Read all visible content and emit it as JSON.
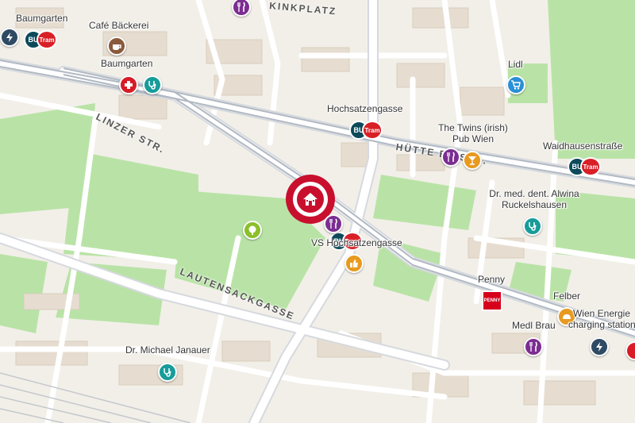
{
  "map": {
    "colors": {
      "background": "#f2efe9",
      "park": "#b9e3a6",
      "building": "#e6ddd0",
      "road": "#ffffff",
      "tramline": "#b0b8c2",
      "home_marker": "#c8102e",
      "restaurant": "#7b2d91",
      "pharmacy": "#d81b27",
      "health": "#179c9a",
      "shop": "#2a8fd6",
      "bar": "#e89a1f",
      "charging": "#2f4a63",
      "park_poi": "#8bbf2b",
      "bakery": "#8a5a3c",
      "penny": "#d6001c"
    },
    "streets": [
      {
        "id": "linzer",
        "text": "LINZER STR."
      },
      {
        "id": "huetteldorfer",
        "text": "HÜTTE  ER STR."
      },
      {
        "id": "lautensack",
        "text": "LAUTENSACKGASSE"
      },
      {
        "id": "kinkplatz",
        "text": "KINKPLATZ"
      }
    ],
    "labels": {
      "baumgarten_top": "Baumgarten",
      "cafe_baeckerei": "Café Bäckerei",
      "baumgarten_mid": "Baumgarten",
      "hochsatzengasse": "Hochsatzengasse",
      "lidl": "Lidl",
      "twins_line1": "The Twins (irish)",
      "twins_line2": "Pub Wien",
      "waidhausen": "Waidhausenstraße",
      "dentist_line1": "Dr. med. dent. Alwina",
      "dentist_line2": "Ruckelshausen",
      "vs_hochsatzengasse": "VS Hochsatzengasse",
      "penny": "Penny",
      "felber": "Felber",
      "wien_energie_line1": "Wien Energie",
      "wien_energie_line2": "charging station",
      "medl_brau": "Medl Brau",
      "janauer": "Dr. Michael Janauer"
    },
    "transit_badges": {
      "bus": "BU",
      "tram": "Tram"
    },
    "penny_logo": "PENNY",
    "icons": {
      "home": "home-icon",
      "restaurant": "fork-knife-icon",
      "pharmacy": "pharmacy-icon",
      "health": "stethoscope-icon",
      "shop": "shopping-cart-icon",
      "bar": "cocktail-icon",
      "charging": "lightning-icon",
      "bakery": "coffee-cup-icon",
      "park": "tree-icon"
    }
  }
}
